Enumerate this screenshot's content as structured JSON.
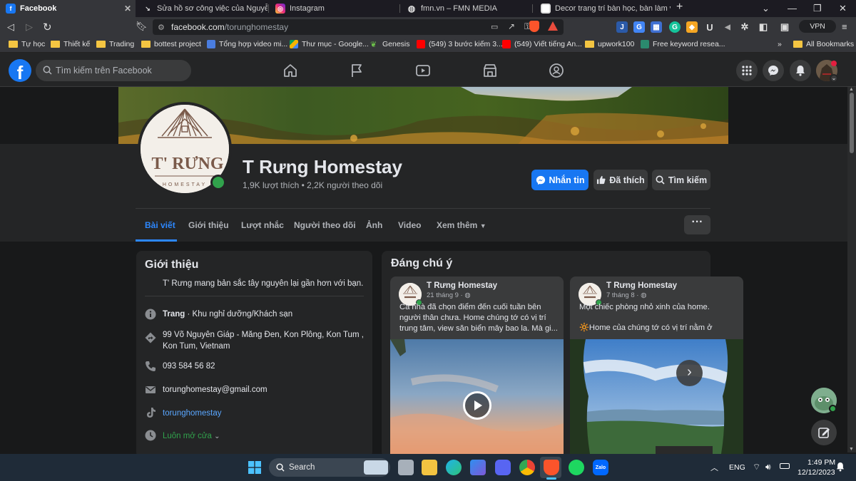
{
  "browser": {
    "tabs": [
      {
        "title": "Facebook",
        "active": true
      },
      {
        "title": "Sửa hồ sơ công việc của Nguyễn Văn C",
        "active": false
      },
      {
        "title": "Instagram",
        "active": false
      },
      {
        "title": "fmn.vn – FMN MEDIA",
        "active": false
      },
      {
        "title": "Decor trang trí bàn học, bàn làm việc |",
        "active": false
      }
    ],
    "new_tab": "+",
    "url_host": "facebook.com",
    "url_path": "/torunghomestay",
    "vpn_label": "VPN",
    "bookmarks": [
      "Tự học",
      "Thiết kế",
      "Trading",
      "bottest project",
      "Tổng hợp video mi...",
      "Thư mục - Google...",
      "Genesis",
      "(549) 3 bước kiếm 3...",
      "(549) Viết tiếng An...",
      "upwork100",
      "Free keyword resea..."
    ],
    "bookmarks_overflow": "»",
    "all_bookmarks": "All Bookmarks"
  },
  "fb": {
    "search_placeholder": "Tìm kiếm trên Facebook"
  },
  "page": {
    "title": "T Rưng Homestay",
    "stats": "1,9K lượt thích • 2,2K người theo dõi",
    "logo_text": "T' RƯNG",
    "logo_sub": "HOMESTAY",
    "buttons": {
      "message": "Nhắn tin",
      "liked": "Đã thích",
      "search": "Tìm kiếm"
    },
    "tabs": [
      "Bài viết",
      "Giới thiệu",
      "Lượt nhắc",
      "Người theo dõi",
      "Ảnh",
      "Video",
      "Xem thêm"
    ],
    "more": "···"
  },
  "intro": {
    "title": "Giới thiệu",
    "bio": "T' Rưng mang bản sắc tây nguyên lại gần hơn với bạn.",
    "category_bold": "Trang",
    "category_rest": " · Khu nghỉ dưỡng/Khách sạn",
    "address_line1": "99 Võ Nguyên Giáp - Măng Đen, Kon Plông, Kon Tum ,",
    "address_line2": "Kon Tum, Vietnam",
    "phone": "093 584 56 82",
    "email": "torunghomestay@gmail.com",
    "instagram": "torunghomestay",
    "hours": "Luôn mở cửa"
  },
  "featured": {
    "title": "Đáng chú ý",
    "cards": [
      {
        "name": "T Rưng Homestay",
        "date": "21 tháng 9 ·",
        "text": "Cả nhà đã chọn điểm đến cuối tuần bên người thân chưa. Home chúng tớ có vị trí trung tâm, view săn biển mây bao la. Mà gi..."
      },
      {
        "name": "T Rưng Homestay",
        "date": "7 tháng 8 ·",
        "text1": "Một chiếc phòng nhỏ xinh của home.",
        "text2": "🔆Home của chúng tớ có vị trí nằm ở"
      }
    ]
  },
  "taskbar": {
    "search": "Search",
    "lang": "ENG",
    "time": "1:49 PM",
    "date": "12/12/2023"
  }
}
